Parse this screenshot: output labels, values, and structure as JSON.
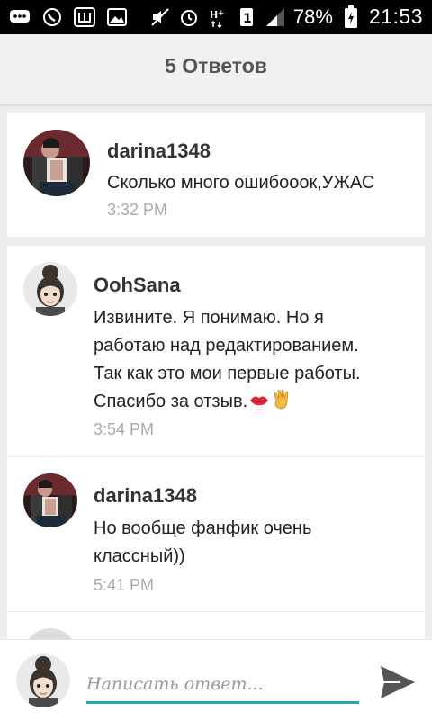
{
  "status_bar": {
    "battery_percent": "78%",
    "time": "21:53",
    "sim_label": "1"
  },
  "header": {
    "title": "5 Ответов"
  },
  "comments": [
    {
      "author": "darina1348",
      "text": "Сколько много ошибооок,УЖАС",
      "time": "3:32 PM",
      "avatar": "darina-avatar"
    },
    {
      "author": "OohSana",
      "text_lines": [
        "Извините. Я понимаю. Но я",
        "работаю над редактированием.",
        "Так как это мои первые работы.",
        "Спасибо за отзыв."
      ],
      "emoji": [
        "kiss-lips",
        "waving-hand"
      ],
      "time": "3:54 PM",
      "avatar": "oohsana-avatar"
    },
    {
      "author": "darina1348",
      "text_lines": [
        "Но вообще фанфик очень",
        "классный))"
      ],
      "time": "5:41 PM",
      "avatar": "darina-avatar"
    }
  ],
  "composer": {
    "placeholder": "Написать ответ..."
  },
  "colors": {
    "accent": "#2aa3b8",
    "header_bg": "#f0f0f0",
    "timestamp": "#aaaaaa",
    "send_icon": "#555555"
  }
}
